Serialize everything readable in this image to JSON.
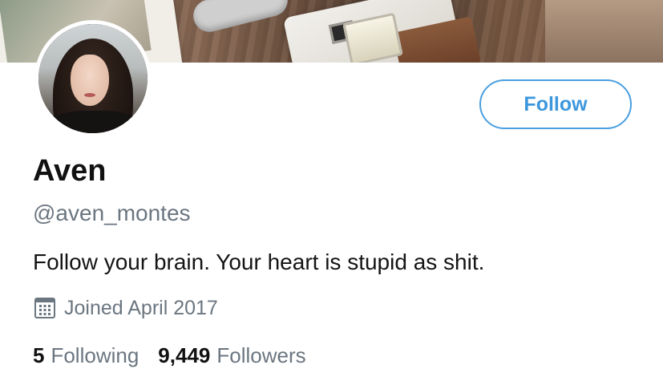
{
  "profile": {
    "name": "Aven",
    "handle": "@aven_montes",
    "bio": "Follow your brain. Your heart is stupid as shit.",
    "joined": "Joined April 2017",
    "follow_label": "Follow"
  },
  "stats": {
    "following_count": "5",
    "following_label": "Following",
    "followers_count": "9,449",
    "followers_label": "Followers"
  },
  "icons": {
    "joined": "calendar-icon"
  },
  "colors": {
    "accent": "#3d97dc",
    "secondary_text": "#6b7680",
    "primary_text": "#111111"
  }
}
